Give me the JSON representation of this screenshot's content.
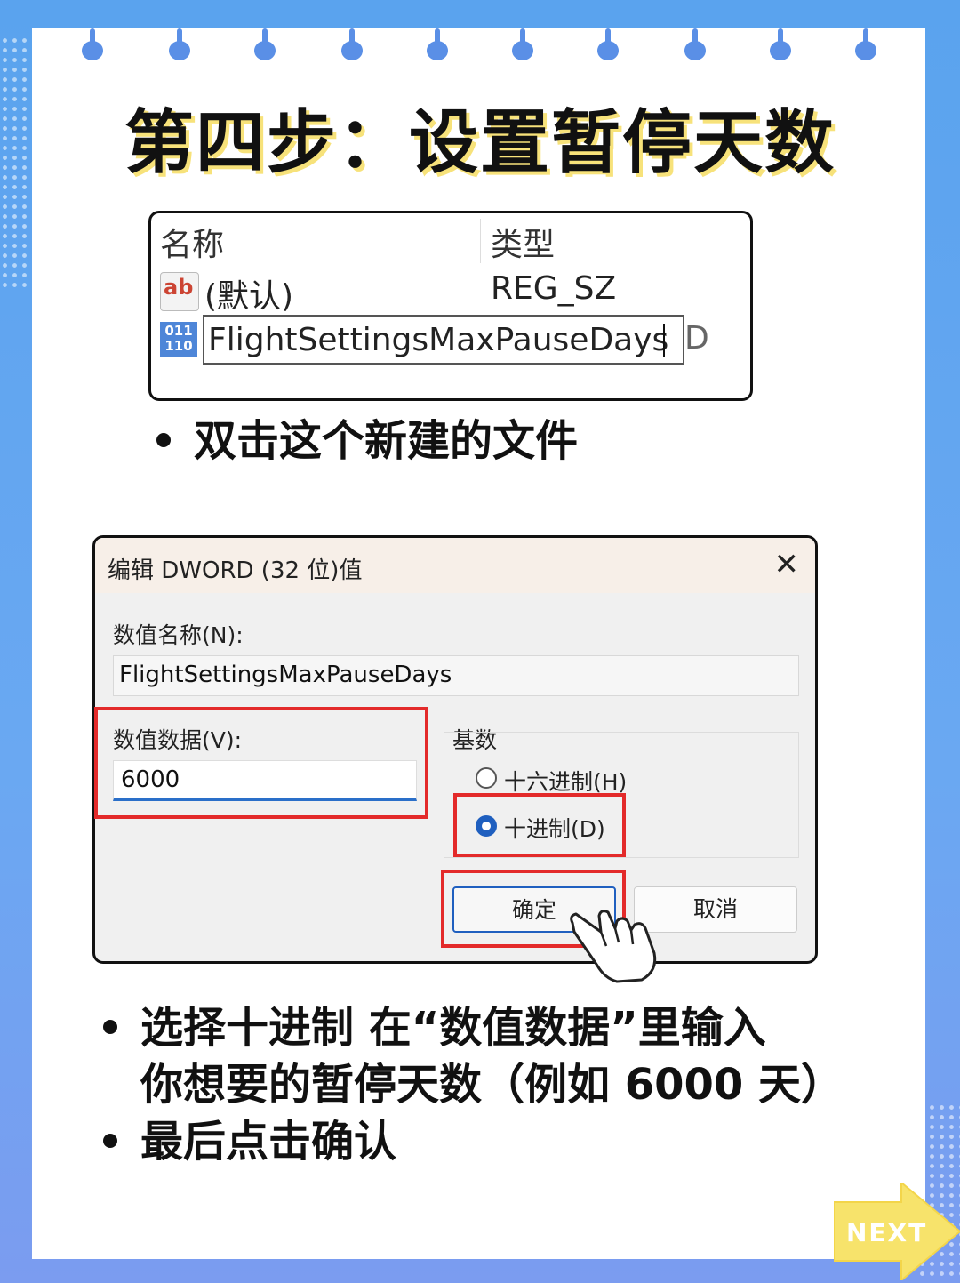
{
  "title": "第四步：设置暂停天数",
  "registry": {
    "col_name": "名称",
    "col_type": "类型",
    "row1_icon": "ab",
    "row1_name": "(默认)",
    "row1_type": "REG_SZ",
    "row2_icon": "011 110",
    "row2_name": "FlightSettingsMaxPauseDays",
    "row2_tail": "D"
  },
  "bullet1": "双击这个新建的文件",
  "dialog": {
    "title": "编辑 DWORD (32 位)值",
    "close": "✕",
    "name_label": "数值名称(N):",
    "name_value": "FlightSettingsMaxPauseDays",
    "data_label": "数值数据(V):",
    "data_value": "6000",
    "base_label": "基数",
    "hex_label": "十六进制(H)",
    "dec_label": "十进制(D)",
    "ok_label": "确定",
    "cancel_label": "取消",
    "selected_base": "decimal"
  },
  "bullet2_line1": "选择十进制 在“数值数据”里输入",
  "bullet2_line2": "你想要的暂停天数（例如 6000 天）",
  "bullet3": "最后点击确认",
  "next_label": "NEXT",
  "colors": {
    "background": "#5aa3ee",
    "ring": "#5a8fe6",
    "highlight": "#e32a2a",
    "next_arrow": "#f7e36b",
    "title_shadow": "#f7e27a"
  }
}
